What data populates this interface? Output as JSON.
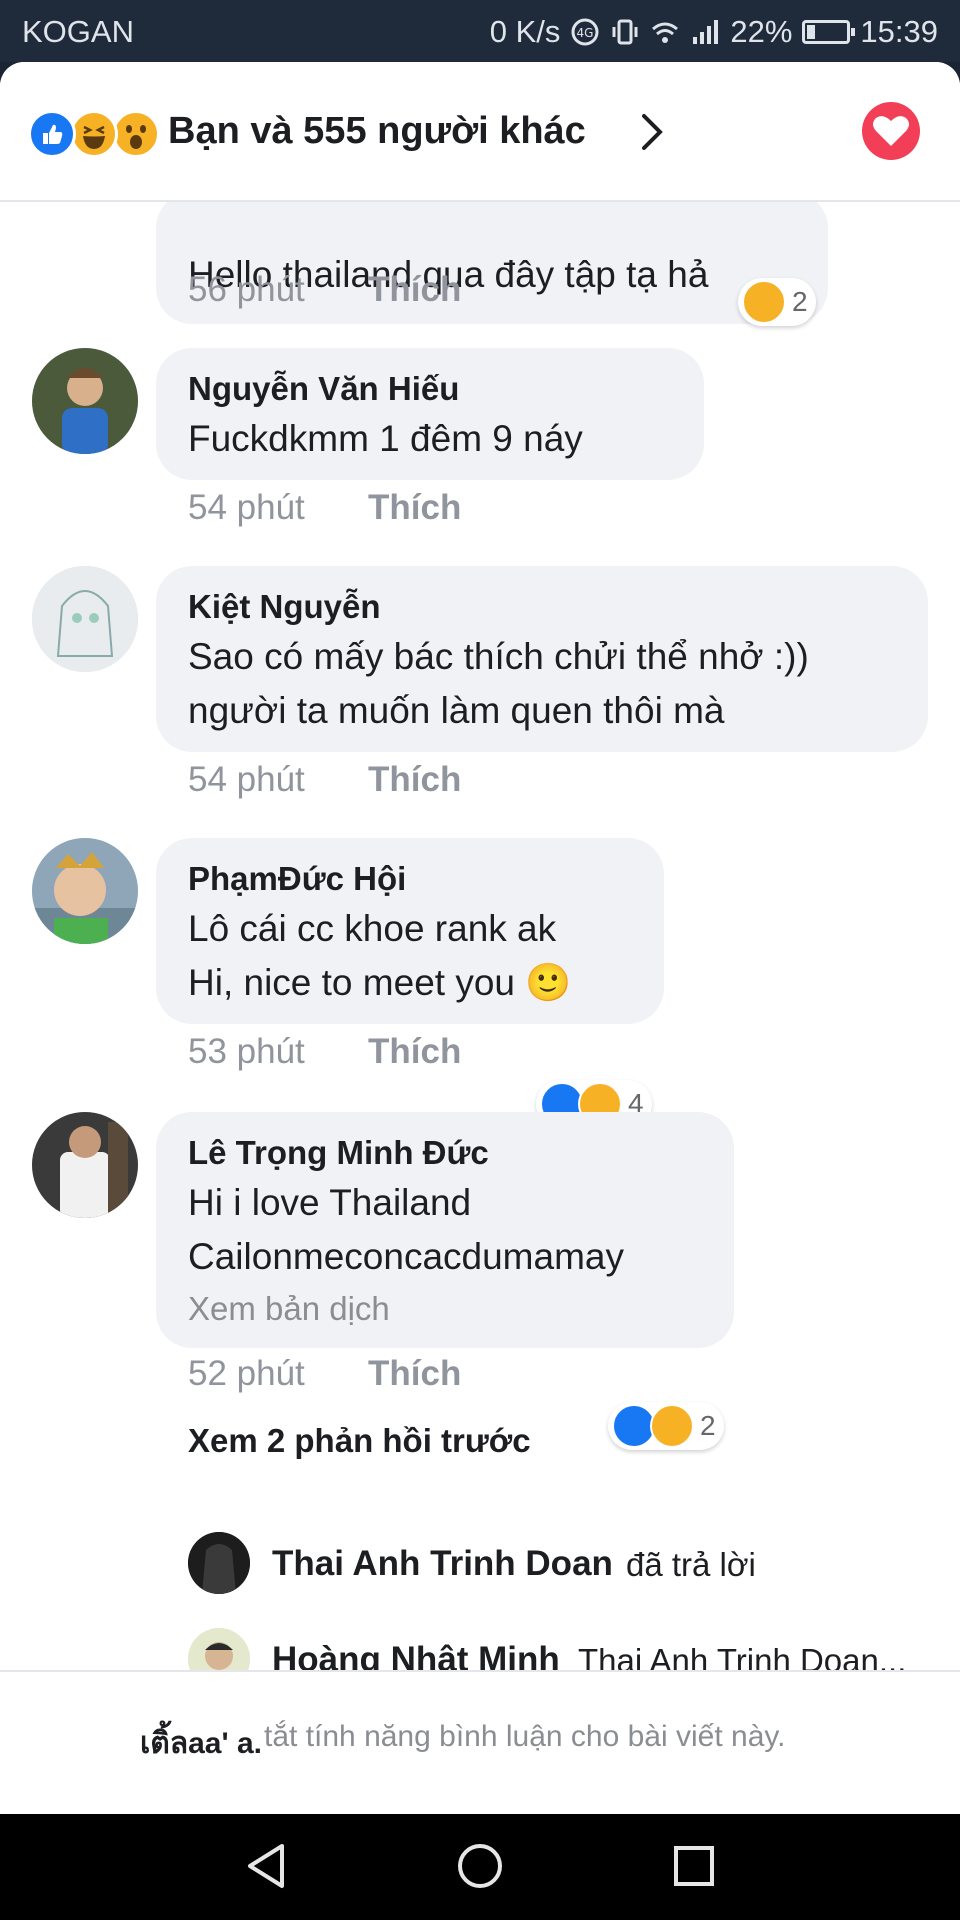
{
  "status_bar": {
    "carrier": "KOGAN",
    "speed": "0 K/s",
    "battery": "22%",
    "battery_level": 0.22,
    "time": "15:39"
  },
  "header": {
    "reactions": [
      "like-icon",
      "haha-icon",
      "wow-icon"
    ],
    "title": "Bạn và 555 người khác"
  },
  "comments": [
    {
      "name": "",
      "lines": [
        "Hello thailand qua đây tập tạ hả"
      ],
      "time": "56 phút",
      "like_label": "Thích",
      "reaction_count": "2",
      "reactions": [
        "haha-icon"
      ]
    },
    {
      "name": "Nguyễn Văn Hiếu",
      "lines": [
        "Fuckdkmm 1 đêm 9 náy"
      ],
      "time": "54 phút",
      "like_label": "Thích"
    },
    {
      "name": "Kiệt Nguyễn",
      "lines": [
        "Sao có mấy bác thích chửi thể nhở :))",
        "người ta muốn làm quen thôi mà"
      ],
      "time": "54 phút",
      "like_label": "Thích"
    },
    {
      "name": "PhạmĐức Hội",
      "lines": [
        "Lô cái cc khoe rank ak",
        "Hi, nice to meet you 🙂"
      ],
      "time": "53 phút",
      "like_label": "Thích",
      "reaction_count": "4",
      "reactions": [
        "like-icon",
        "haha-icon"
      ]
    },
    {
      "name": "Lê Trọng Minh Đức",
      "lines": [
        "Hi i love Thailand",
        "Cailonmeconcacdumamay"
      ],
      "translate": "Xem bản dịch",
      "time": "52 phút",
      "like_label": "Thích",
      "reaction_count": "2",
      "reactions": [
        "like-icon",
        "haha-icon"
      ]
    }
  ],
  "replies": {
    "more_label": "Xem 2 phản hồi trước",
    "items": [
      {
        "name": "Thai Anh Trinh Doan",
        "text": "đã trả lời"
      },
      {
        "name": "Hoàng Nhật Minh",
        "text": "Thai Anh Trinh Doan..."
      }
    ]
  },
  "footer": {
    "name": "เติ้ลaa' a.",
    "text": "tắt tính năng bình luận cho bài viết này."
  },
  "colors": {
    "like_blue": "#1877f2",
    "haha_yellow": "#f7b125",
    "love_red": "#f33e58",
    "bubble_gray": "#f0f2f5"
  }
}
